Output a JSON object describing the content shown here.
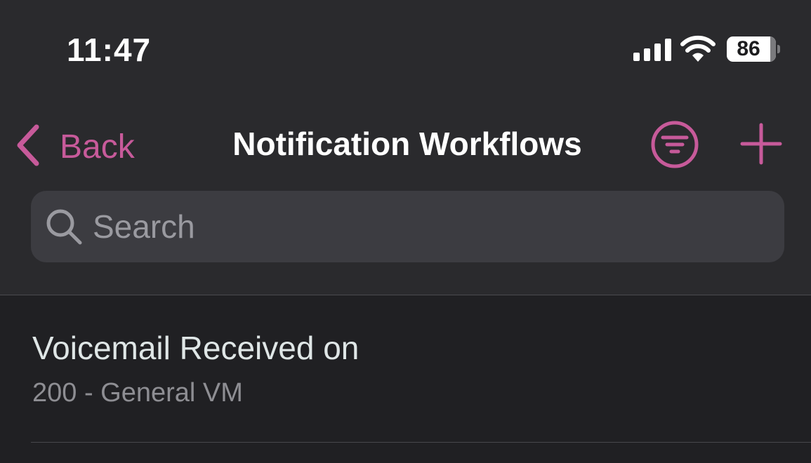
{
  "status_bar": {
    "time": "11:47",
    "battery_level": "86",
    "icons": [
      "signal-icon",
      "wifi-icon",
      "battery-icon"
    ]
  },
  "nav": {
    "back_label": "Back",
    "title": "Notification Workflows",
    "filter_icon": "filter-icon",
    "add_icon": "plus-icon"
  },
  "search": {
    "placeholder": "Search",
    "value": ""
  },
  "list": {
    "items": [
      {
        "title": "Voicemail Received on",
        "subtitle": "200 - General VM"
      }
    ]
  },
  "colors": {
    "accent": "#c75a9a",
    "background": "#202023",
    "header_background": "#2a2a2d",
    "search_background": "#3c3c41"
  }
}
